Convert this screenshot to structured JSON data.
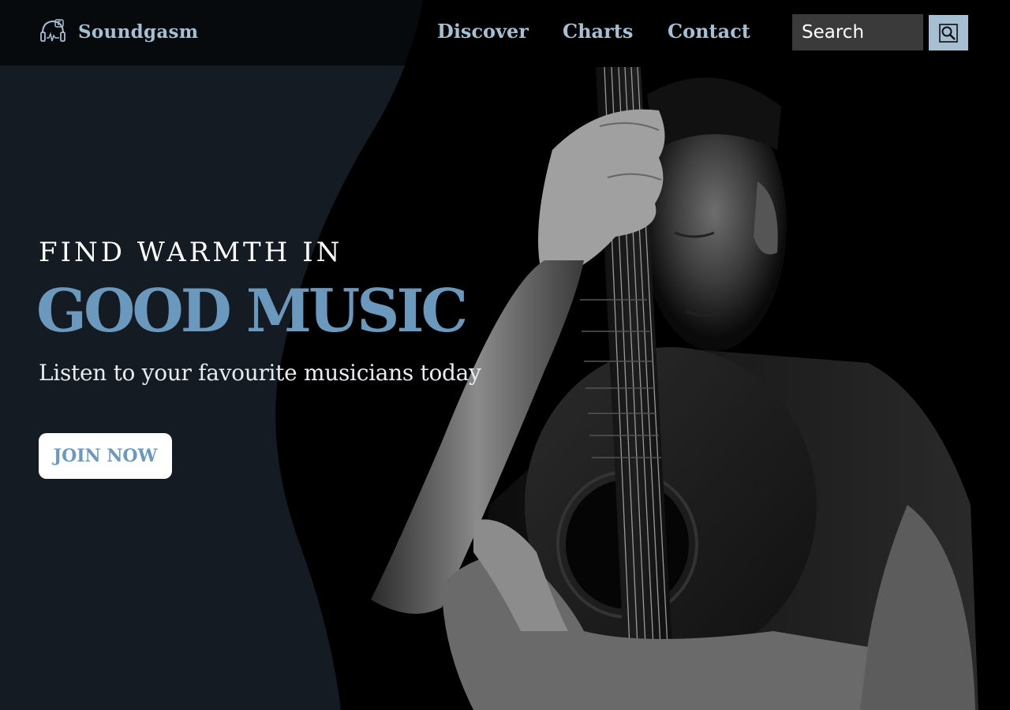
{
  "header": {
    "brand_name": "Soundgasm",
    "logo_icon": "elephant-headphones-logo-icon",
    "nav": [
      {
        "label": "Discover"
      },
      {
        "label": "Charts"
      },
      {
        "label": "Contact"
      }
    ],
    "search": {
      "placeholder": "Search",
      "button_icon": "search-icon"
    }
  },
  "hero": {
    "kicker": "FIND WARMTH IN",
    "title": "GOOD MUSIC",
    "subtitle": "Listen to your favourite musicians today",
    "cta_label": "JOIN NOW",
    "image_icon": "guitarist-photo"
  },
  "colors": {
    "accent": "#6a99bd",
    "nav_text": "#a6bfd3",
    "panel": "#141b22",
    "header_bg": "#060a0c",
    "search_bg": "#3a3a3a"
  }
}
